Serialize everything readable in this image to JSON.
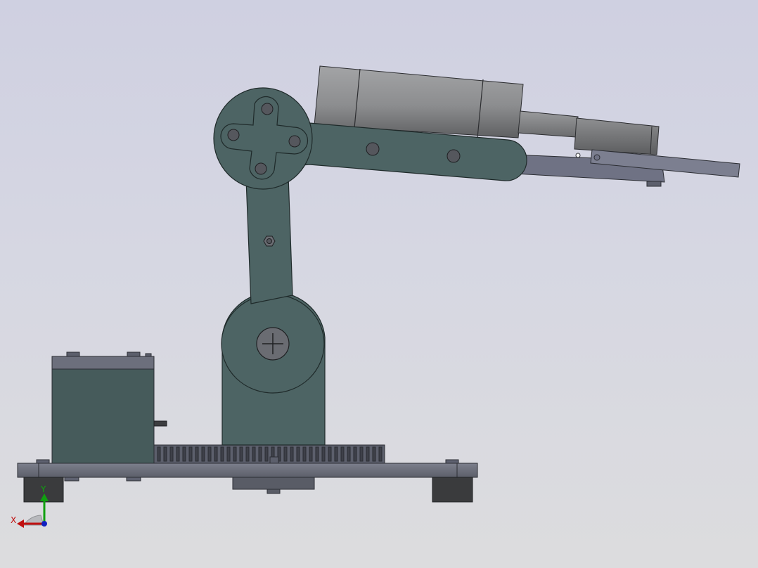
{
  "triad": {
    "x_label": "X",
    "y_label": "Y"
  },
  "colors": {
    "background_top": "#cfd0e1",
    "background_bottom": "#dcdcde",
    "arm_link": "#4d6464",
    "servo_body": "#44595a",
    "base_plate": "#6f7280",
    "motor_cylinder": "#8d8e90",
    "axis_x": "#c01010",
    "axis_y": "#10a010",
    "axis_z": "#1020c0"
  },
  "icons": {
    "orientation_triad": "orientation-triad-icon"
  }
}
